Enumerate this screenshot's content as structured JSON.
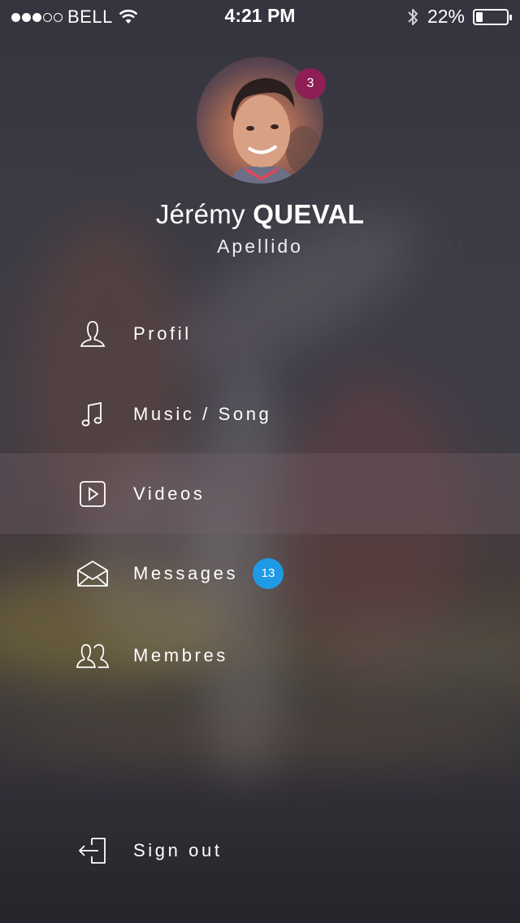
{
  "status_bar": {
    "signal_bars_filled": 3,
    "signal_bars_total": 5,
    "carrier": "BELL",
    "time": "4:21 PM",
    "battery_percent": "22%",
    "battery_level": 0.22
  },
  "profile": {
    "notifications_count": "3",
    "first_name": "Jérémy",
    "last_name": "QUEVAL",
    "subtitle": "Apellido"
  },
  "menu": {
    "items": [
      {
        "label": "Profil",
        "icon": "user-icon"
      },
      {
        "label": "Music / Song",
        "icon": "music-note-icon"
      },
      {
        "label": "Videos",
        "icon": "play-icon",
        "active": true
      },
      {
        "label": "Messages",
        "icon": "envelope-icon",
        "badge": "13"
      },
      {
        "label": "Membres",
        "icon": "users-icon"
      }
    ],
    "sign_out": {
      "label": "Sign out",
      "icon": "sign-out-icon"
    }
  },
  "colors": {
    "profile_badge": "#8e1f55",
    "messages_badge": "#1f9ae6"
  }
}
